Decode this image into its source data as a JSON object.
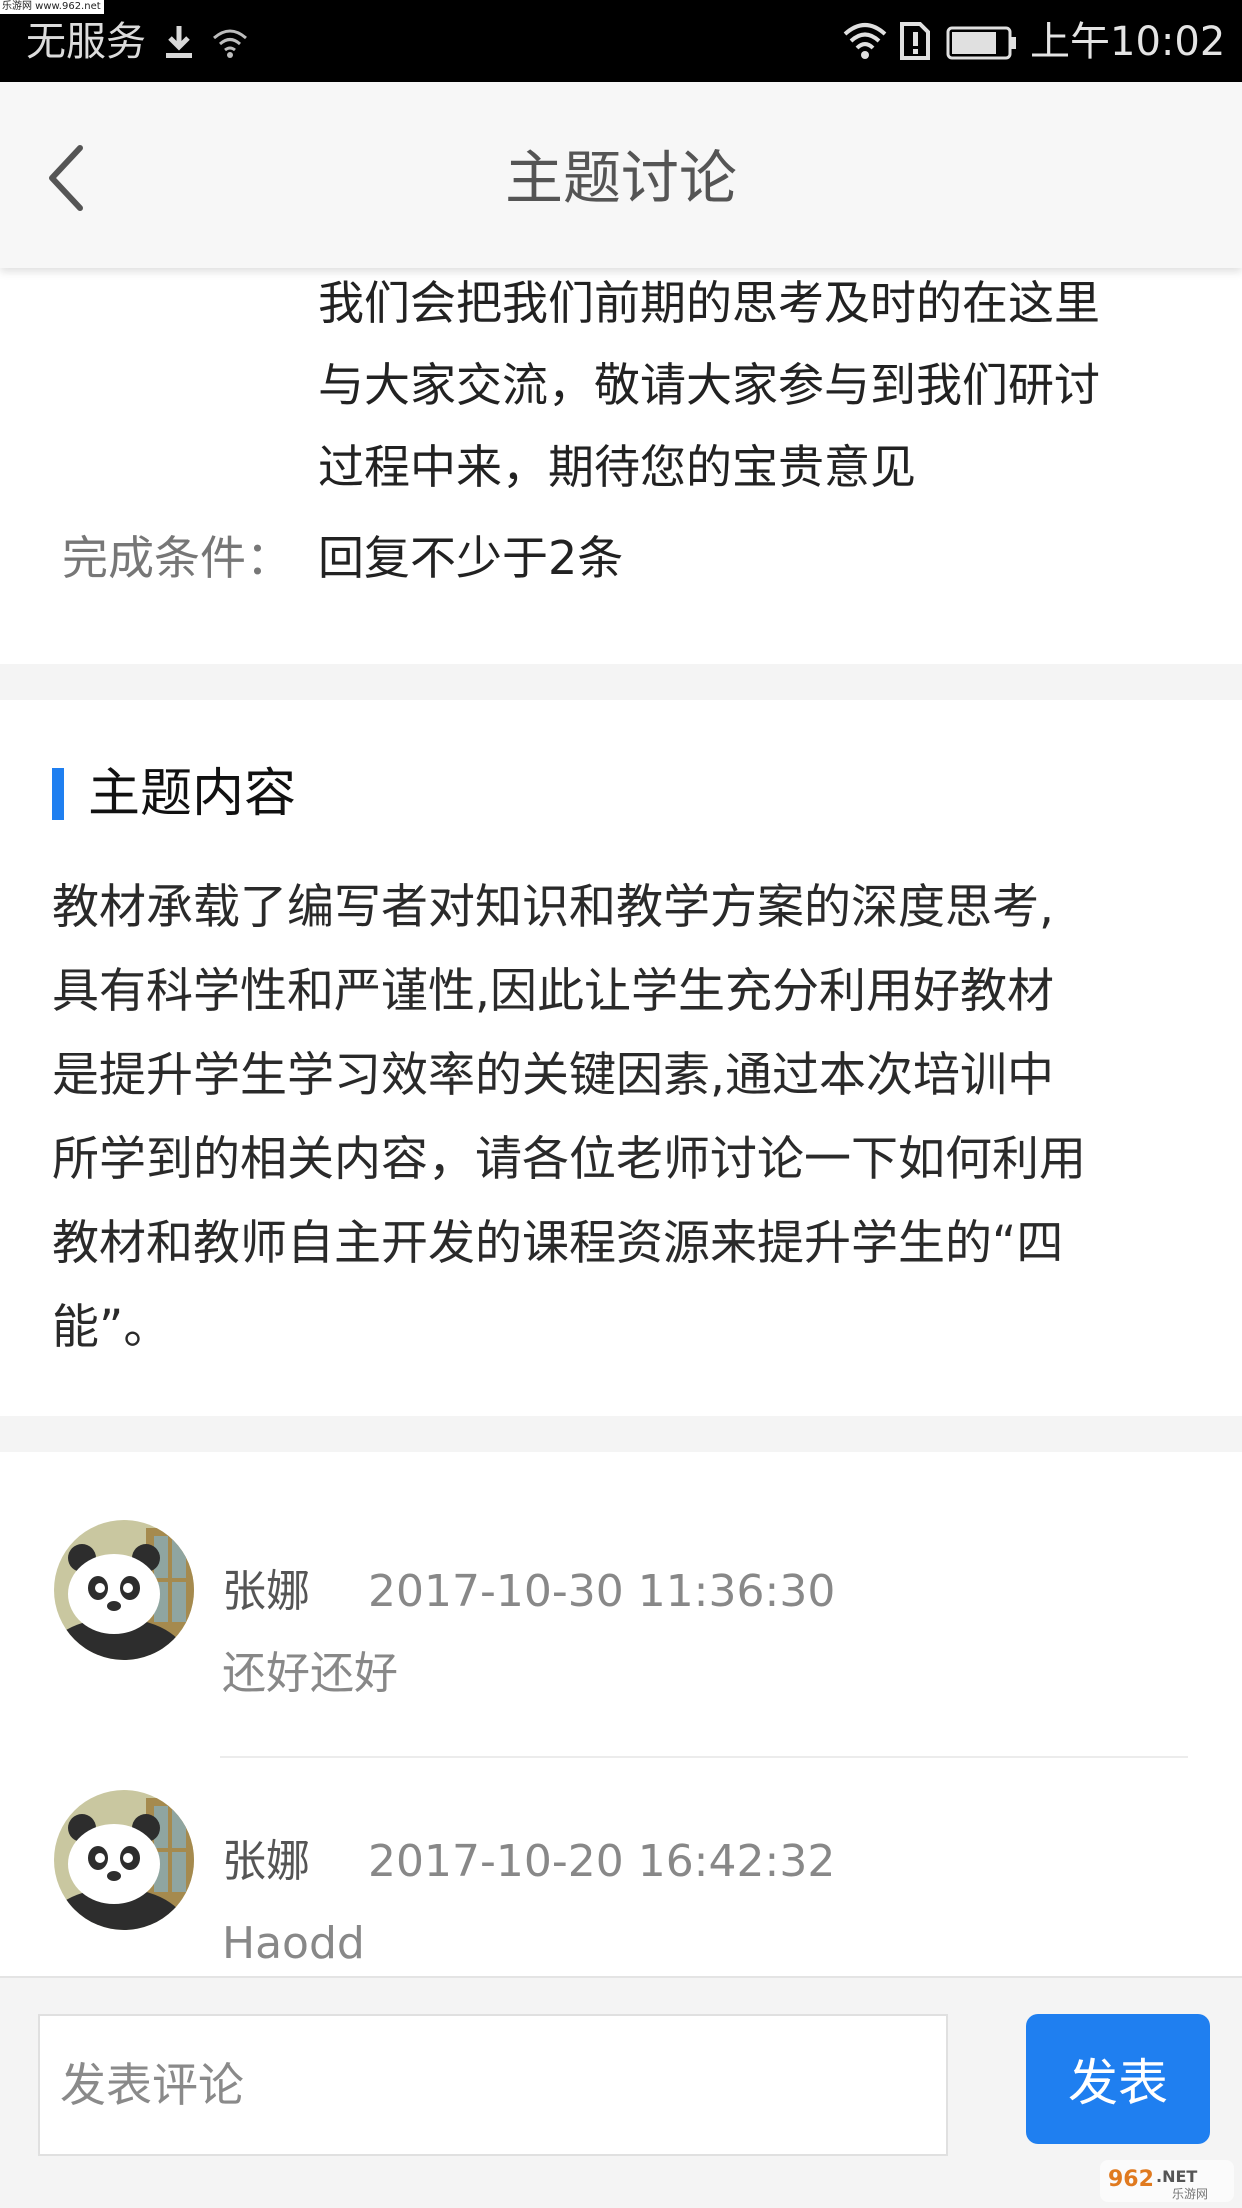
{
  "status_bar": {
    "watermark": "乐游网 www.962.net",
    "carrier": "无服务",
    "time": "上午10:02"
  },
  "header": {
    "title": "主题讨论"
  },
  "description": {
    "lines": [
      "我们会把我们前期的思考及时的在这里",
      "与大家交流，敬请大家参与到我们研讨",
      "过程中来，期待您的宝贵意见"
    ],
    "condition_label": "完成条件：",
    "condition_value": "回复不少于2条"
  },
  "topic": {
    "heading": "主题内容",
    "lines": [
      "教材承载了编写者对知识和教学方案的深度思考,",
      "具有科学性和严谨性,因此让学生充分利用好教材",
      "是提升学生学习效率的关键因素,通过本次培训中",
      "所学到的相关内容，请各位老师讨论一下如何利用",
      "教材和教师自主开发的课程资源来提升学生的“四",
      "能”。"
    ]
  },
  "comments": [
    {
      "name": "张娜",
      "time": "2017-10-30 11:36:30",
      "text": "还好还好"
    },
    {
      "name": "张娜",
      "time": "2017-10-20 16:42:32",
      "text": "Haodd"
    }
  ],
  "footer": {
    "input_placeholder": "发表评论",
    "send_label": "发表"
  },
  "logo": {
    "text": "962.NET",
    "subtext": "乐游网"
  },
  "colors": {
    "accent": "#1f7ff0",
    "statusbar": "#000000",
    "header_bg": "#f7f7f7",
    "band": "#f4f4f4"
  }
}
